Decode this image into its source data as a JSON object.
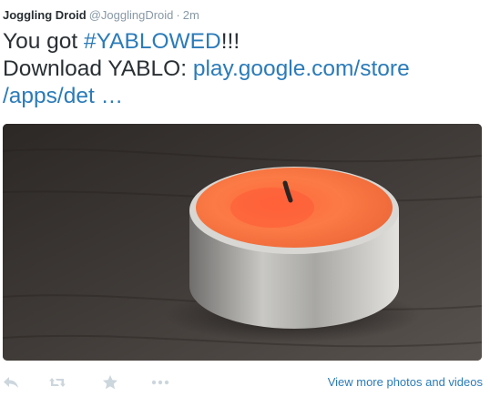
{
  "tweet": {
    "author_name": "Joggling Droid",
    "handle": "@JogglingDroid",
    "separator": "·",
    "timestamp": "2m",
    "text_prefix": "You got ",
    "hashtag": "#YABLOWED",
    "text_suffix": "!!!",
    "download_prefix": " Download YABLO: ",
    "link_part1": "play.google.com/store",
    "link_part2": "/apps/det …"
  },
  "media": {
    "photo": "tealight-candle-photo"
  },
  "actions": {
    "icons": [
      "reply-icon",
      "retweet-icon",
      "favorite-icon",
      "more-icon"
    ],
    "view_more_label": "View more photos and videos"
  },
  "colors": {
    "link": "#2b7bb9",
    "text": "#292f33",
    "muted": "#8899a6",
    "icon": "#ccd6dd"
  }
}
